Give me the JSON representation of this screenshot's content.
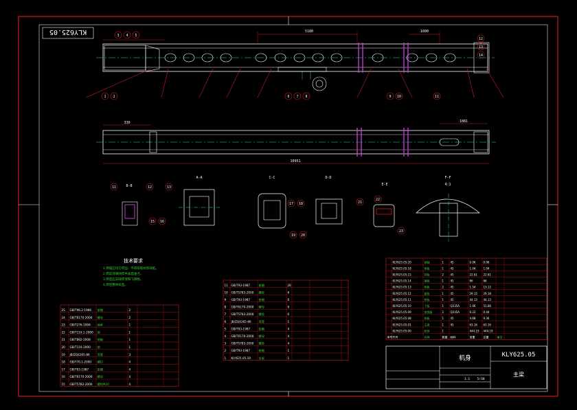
{
  "title_block": {
    "stamp_top_left": "KLY625.05",
    "drawing_no": "KLY625.05",
    "name": "机身",
    "subtitle": "主梁",
    "scale": "1:1",
    "sheet": "5/30"
  },
  "sections": {
    "aa": "A-A",
    "bb": "B-B",
    "cc": "C-C",
    "dd": "D-D",
    "ee": "E-E",
    "ff": "F-F",
    "ratio": "4:1"
  },
  "tech_requirements": {
    "heading": "技术要求",
    "lines": [
      "1.焊缝应均匀牢固，不得有裂纹等缺陷。",
      "2.焊前须清除焊件表面油污。",
      "3.焊后应去除焊渣和飞溅物。",
      "4.焊后整体校直。"
    ]
  },
  "dimensions": {
    "top_span": "5180",
    "top_span2": "1600",
    "overall": "10951",
    "plan_left": "330",
    "plan_right": "1081"
  },
  "callouts_top": [
    "3",
    "4",
    "5",
    "12",
    "13",
    "14",
    "1",
    "2",
    "6",
    "7",
    "8",
    "9",
    "10",
    "11"
  ],
  "callouts_mid": [
    "11",
    "12",
    "13",
    "15",
    "16",
    "17",
    "18",
    "19",
    "20",
    "21",
    "22",
    "23"
  ],
  "bom_left": [
    [
      "25",
      "GB/T96.2-1986",
      "垫圈",
      "2",
      ""
    ],
    [
      "24",
      "GB/T6170-2000",
      "螺母",
      "2",
      ""
    ],
    [
      "23",
      "GB/T276-1994",
      "轴承",
      "1",
      ""
    ],
    [
      "22",
      "GB/T119.1-2000",
      "销",
      "1",
      ""
    ],
    [
      "21",
      "GB/T882-2008",
      "销轴",
      "1",
      ""
    ],
    [
      "20",
      "GB/T119-2000",
      "销",
      "1",
      ""
    ],
    [
      "19",
      "JB/ZQ4265-86",
      "弯管",
      "3",
      ""
    ],
    [
      "18",
      "GB/T70.1-2000",
      "螺钉",
      "4",
      ""
    ],
    [
      "17",
      "GB/T93-1987",
      "垫圈",
      "4",
      ""
    ],
    [
      "16",
      "GB/T6170-2000",
      "螺母",
      "4",
      ""
    ],
    [
      "15",
      "GB/T5782-2000",
      "螺栓M20",
      "4",
      ""
    ]
  ],
  "bom_mid": [
    [
      "11",
      "GB/T93-1987",
      "垫圈",
      "26",
      ""
    ],
    [
      "10",
      "GB/T5783-2000",
      "螺栓",
      "6",
      ""
    ],
    [
      "9",
      "GB/T93-1987",
      "垫圈",
      "6",
      ""
    ],
    [
      "8",
      "GB/T6170-2000",
      "螺母",
      "6",
      ""
    ],
    [
      "7",
      "GB/T5783-2000",
      "螺栓",
      "6",
      ""
    ],
    [
      "6",
      "JB/ZQ4265-86",
      "弯管",
      "1",
      ""
    ],
    [
      "5",
      "GB/T93-1987",
      "垫圈",
      "4",
      ""
    ],
    [
      "4",
      "GB/T6170-2000",
      "螺母",
      "4",
      ""
    ],
    [
      "3",
      "GB/T5783-2000",
      "螺栓",
      "4",
      ""
    ],
    [
      "2",
      "GB/T93-1987",
      "垫圈",
      "1",
      ""
    ],
    [
      "1",
      "KLY625.05.19",
      "支架",
      "1",
      ""
    ]
  ],
  "bom_right": [
    [
      "",
      "KLY625.05.20",
      "销轴",
      "1",
      "45",
      "0.06",
      "0.06",
      ""
    ],
    [
      "",
      "KLY625.05.18",
      "垫板",
      "1",
      "45",
      "1.04",
      "1.04",
      ""
    ],
    [
      "",
      "KLY625.05.15",
      "挡板",
      "2",
      "45",
      "22.61",
      "22.61",
      ""
    ],
    [
      "",
      "KLY625.05.14",
      "端板",
      "1",
      "45",
      "66",
      "66",
      ""
    ],
    [
      "",
      "KLY625.05.13",
      "侧板",
      "2",
      "45",
      "1.54",
      "13.12",
      ""
    ],
    [
      "",
      "KLY625.05.12",
      "盖板",
      "1",
      "45",
      "29.15",
      "29.18",
      ""
    ],
    [
      "",
      "KLY625.05.11",
      "底板",
      "1",
      "45",
      "44.13",
      "44.13",
      ""
    ],
    [
      "",
      "KLY625.05.10",
      "下板",
      "1",
      "Q235A",
      "1.06",
      "51.66",
      ""
    ],
    [
      "",
      "KLY625.05.09",
      "加强板",
      "2",
      "Q235A",
      "0.22",
      "0.44",
      ""
    ],
    [
      "",
      "KLY625.05.08",
      "侧板",
      "1",
      "45",
      "4.68",
      "9.36",
      ""
    ],
    [
      "",
      "KLY625.05.01",
      "主梁",
      "1",
      "45",
      "63.16",
      "63.16",
      ""
    ],
    [
      "",
      "KLY625.05.00",
      "机身",
      "1",
      "",
      "444.19",
      "444.19",
      ""
    ]
  ],
  "bom_right_header": [
    "序号",
    "代号",
    "名称",
    "数量",
    "材料",
    "单重",
    "总重",
    "备注"
  ]
}
